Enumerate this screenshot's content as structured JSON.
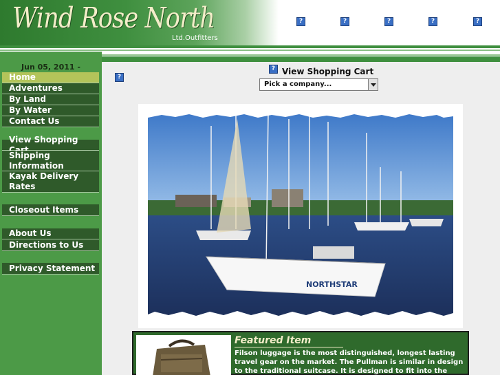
{
  "header": {
    "logo_title": "Wind Rose North",
    "logo_subtitle": "Ltd.Outfitters",
    "icons": [
      "broken-image-icon",
      "broken-image-icon",
      "broken-image-icon",
      "broken-image-icon",
      "broken-image-icon"
    ]
  },
  "sidebar": {
    "date": "Jun 05, 2011 -",
    "items": [
      {
        "label": "Home",
        "active": true
      },
      {
        "label": "Adventures"
      },
      {
        "label": "By Land"
      },
      {
        "label": "By Water"
      },
      {
        "label": "Contact Us"
      },
      {
        "label": "View Shopping Cart"
      },
      {
        "label": "Shipping Information"
      },
      {
        "label": "Kayak Delivery Rates"
      },
      {
        "label": "Closeout Items"
      },
      {
        "label": "About Us"
      },
      {
        "label": "Directions to Us"
      },
      {
        "label": "Privacy Statement"
      }
    ]
  },
  "main": {
    "cart_link": "View Shopping Cart",
    "company_select": "Pick a company...",
    "photo_caption_boat": "NORTHSTAR"
  },
  "featured": {
    "title": "Featured Item",
    "text": "Filson luggage is the most distinguished, longest lasting travel gear on the market. The Pullman is similar in design to the traditional suitcase. It is designed to fit into the overhead"
  },
  "colors": {
    "brand_green": "#3f8f3f",
    "nav_dark": "#2f5a2a",
    "nav_active": "#b3c45a",
    "logo_text": "#f3edc9"
  }
}
